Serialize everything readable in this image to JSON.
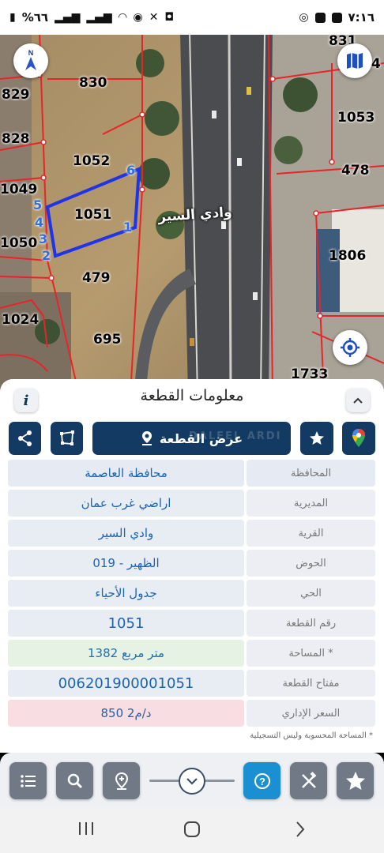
{
  "status_bar": {
    "time": "٧:١٦",
    "battery": "%٦٦",
    "icons": [
      "whatsapp-icon",
      "image-icon",
      "screen-icon",
      "battery-icon",
      "signal-icon",
      "wifi-icon",
      "location-icon",
      "mute-icon"
    ]
  },
  "map": {
    "road_label": "وادي السير",
    "parcels": [
      "830",
      "829",
      "828",
      "1052",
      "1049",
      "1051",
      "1050",
      "479",
      "1024",
      "695",
      "831",
      "1053",
      "478",
      "1806",
      "1733",
      "4"
    ],
    "vertices": [
      "6",
      "5",
      "4",
      "3",
      "2",
      "1"
    ],
    "colors": {
      "boundary": "#e8242a",
      "selection": "#1f33e8",
      "vertex_label": "#2f6ee0"
    }
  },
  "panel": {
    "title": "معلومات القطعة",
    "info_label": "i",
    "show_parcel_label": "عرض القطعة",
    "watermark": "DALEEL ARDI",
    "rows": [
      {
        "label": "المحافظة",
        "value": "محافظة العاصمة"
      },
      {
        "label": "المديرية",
        "value": "اراضي غرب عمان"
      },
      {
        "label": "القرية",
        "value": "وادي السير"
      },
      {
        "label": "الحوض",
        "value": "الظهير - 019"
      },
      {
        "label": "الحي",
        "value": "جدول الأحياء"
      },
      {
        "label": "رقم القطعة",
        "value": "1051"
      },
      {
        "label": "المساحة *",
        "value": "1382  متر مربع"
      },
      {
        "label": "مفتاح القطعة",
        "value": "006201900001051"
      },
      {
        "label": "السعر الإداري",
        "value": "850 د/م2"
      }
    ],
    "footnote": "* المساحة المحسوبة وليس التسجيلية",
    "colors": {
      "primary": "#133a63",
      "value_text": "#1a64b0",
      "area_bg": "#e5f2e4",
      "price_bg": "#f8dde2"
    }
  },
  "toolbar": {
    "buttons": [
      "list-icon",
      "search-icon",
      "location-pin-icon",
      "help-icon",
      "tools-icon",
      "favorites-icon"
    ],
    "help_color": "#1a8fd1"
  }
}
